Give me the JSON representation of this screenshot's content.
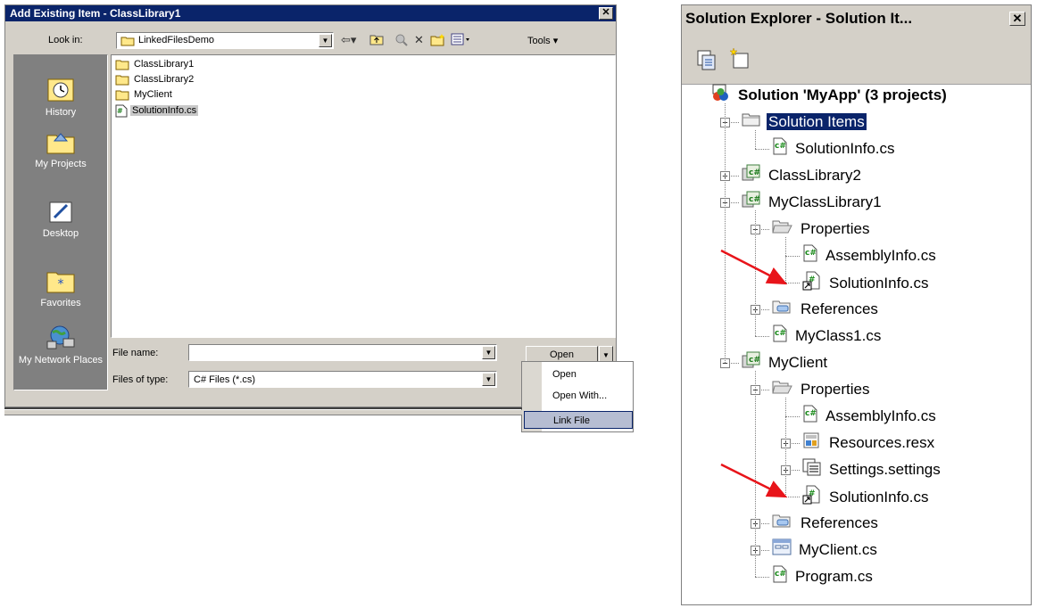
{
  "dialog": {
    "title": "Add Existing Item - ClassLibrary1",
    "close_label": "✕",
    "look_in_label": "Look in:",
    "look_in_value": "LinkedFilesDemo",
    "tools_label": "Tools ▾",
    "places": [
      {
        "label": "History",
        "icon": "history-icon"
      },
      {
        "label": "My Projects",
        "icon": "my-projects-icon"
      },
      {
        "label": "Desktop",
        "icon": "desktop-icon"
      },
      {
        "label": "Favorites",
        "icon": "favorites-icon"
      },
      {
        "label": "My Network Places",
        "icon": "network-places-icon"
      }
    ],
    "files": [
      {
        "name": "ClassLibrary1",
        "type": "folder"
      },
      {
        "name": "ClassLibrary2",
        "type": "folder"
      },
      {
        "name": "MyClient",
        "type": "folder"
      },
      {
        "name": "SolutionInfo.cs",
        "type": "cs-file",
        "selected": true
      }
    ],
    "file_name_label": "File name:",
    "file_name_value": "",
    "files_of_type_label": "Files of type:",
    "files_of_type_value": "C# Files (*.cs)",
    "open_label": "Open",
    "open_menu": [
      "Open",
      "Open With...",
      "Link File"
    ],
    "open_menu_highlighted": "Link File"
  },
  "solution_explorer": {
    "title": "Solution Explorer - Solution It...",
    "close_label": "✕",
    "tree": [
      {
        "label": "Solution 'MyApp' (3 projects)",
        "icon": "solution-icon",
        "depth": 0,
        "bold": true
      },
      {
        "label": "Solution Items",
        "icon": "folder-icon",
        "depth": 1,
        "expander": "−",
        "selected": true
      },
      {
        "label": "SolutionInfo.cs",
        "icon": "cs-file-icon",
        "depth": 2
      },
      {
        "label": "ClassLibrary2",
        "icon": "cs-project-icon",
        "depth": 1,
        "expander": "+"
      },
      {
        "label": "MyClassLibrary1",
        "icon": "cs-project-icon",
        "depth": 1,
        "expander": "−"
      },
      {
        "label": "Properties",
        "icon": "properties-folder-icon",
        "depth": 2,
        "expander": "−"
      },
      {
        "label": "AssemblyInfo.cs",
        "icon": "cs-file-icon",
        "depth": 3
      },
      {
        "label": "SolutionInfo.cs",
        "icon": "cs-link-icon",
        "depth": 3
      },
      {
        "label": "References",
        "icon": "references-icon",
        "depth": 2,
        "expander": "+"
      },
      {
        "label": "MyClass1.cs",
        "icon": "cs-file-icon",
        "depth": 2
      },
      {
        "label": "MyClient",
        "icon": "cs-project-icon",
        "depth": 1,
        "expander": "−"
      },
      {
        "label": "Properties",
        "icon": "properties-folder-icon",
        "depth": 2,
        "expander": "−"
      },
      {
        "label": "AssemblyInfo.cs",
        "icon": "cs-file-icon",
        "depth": 3
      },
      {
        "label": "Resources.resx",
        "icon": "resx-icon",
        "depth": 3,
        "expander": "+"
      },
      {
        "label": "Settings.settings",
        "icon": "settings-icon",
        "depth": 3,
        "expander": "+"
      },
      {
        "label": "SolutionInfo.cs",
        "icon": "cs-link-icon",
        "depth": 3
      },
      {
        "label": "References",
        "icon": "references-icon",
        "depth": 2,
        "expander": "+"
      },
      {
        "label": "MyClient.cs",
        "icon": "form-icon",
        "depth": 2,
        "expander": "+"
      },
      {
        "label": "Program.cs",
        "icon": "cs-file-icon",
        "depth": 2
      }
    ]
  },
  "colors": {
    "titlebar": "#0a246a",
    "face": "#d4d0c8",
    "selection": "#0a246a",
    "arrow": "#e8141a"
  }
}
